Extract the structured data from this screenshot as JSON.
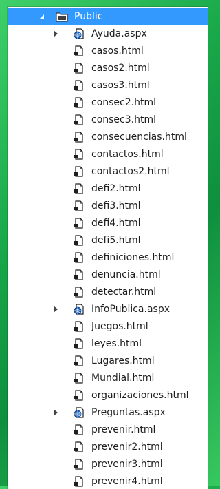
{
  "tree": {
    "root": {
      "label": "Public",
      "expanded": true,
      "icon": "folder-icon"
    },
    "items": [
      {
        "label": "Ayuda.aspx",
        "type": "aspx",
        "expandable": true
      },
      {
        "label": "casos.html",
        "type": "html"
      },
      {
        "label": "casos2.html",
        "type": "html"
      },
      {
        "label": "casos3.html",
        "type": "html"
      },
      {
        "label": "consec2.html",
        "type": "html"
      },
      {
        "label": "consec3.html",
        "type": "html"
      },
      {
        "label": "consecuencias.html",
        "type": "html"
      },
      {
        "label": "contactos.html",
        "type": "html"
      },
      {
        "label": "contactos2.html",
        "type": "html"
      },
      {
        "label": "defi2.html",
        "type": "html"
      },
      {
        "label": "defi3.html",
        "type": "html"
      },
      {
        "label": "defi4.html",
        "type": "html"
      },
      {
        "label": "defi5.html",
        "type": "html"
      },
      {
        "label": "definiciones.html",
        "type": "html"
      },
      {
        "label": "denuncia.html",
        "type": "html"
      },
      {
        "label": "detectar.html",
        "type": "html"
      },
      {
        "label": "InfoPublica.aspx",
        "type": "aspx",
        "expandable": true
      },
      {
        "label": "Juegos.html",
        "type": "html"
      },
      {
        "label": "leyes.html",
        "type": "html"
      },
      {
        "label": "Lugares.html",
        "type": "html"
      },
      {
        "label": "Mundial.html",
        "type": "html"
      },
      {
        "label": "organizaciones.html",
        "type": "html"
      },
      {
        "label": "Preguntas.aspx",
        "type": "aspx",
        "expandable": true
      },
      {
        "label": "prevenir.html",
        "type": "html"
      },
      {
        "label": "prevenir2.html",
        "type": "html"
      },
      {
        "label": "prevenir3.html",
        "type": "html"
      },
      {
        "label": "prevenir4.html",
        "type": "html"
      }
    ]
  },
  "colors": {
    "selection": "#3399ff",
    "background_green": "#1aa84b"
  }
}
